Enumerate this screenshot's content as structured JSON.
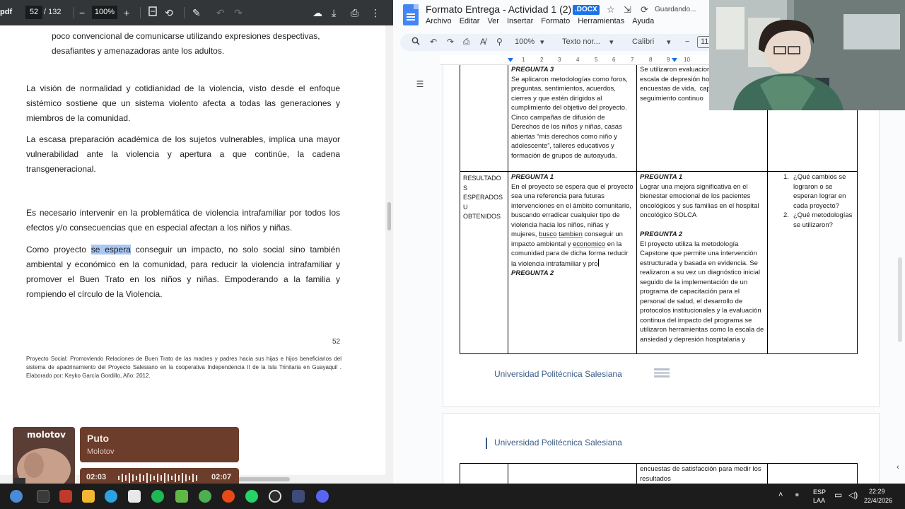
{
  "pdf_viewer": {
    "title_fragment": "pdf",
    "current_page": "52",
    "total_pages": "/ 132",
    "zoom": "100%",
    "paragraphs": {
      "p0_line1": "poco convencional de comunicarse utilizando expresiones despectivas,",
      "p0_line2": "desafiantes y amenazadoras ante los adultos.",
      "p1": "La visión de normalidad y cotidianidad de la violencia, visto desde el enfoque sistémico sostiene que un sistema violento afecta a todas las generaciones y miembros de la comunidad.",
      "p2": "La escasa preparación académica de los sujetos vulnerables, implica una mayor vulnerabilidad ante la violencia y apertura a que continúe, la cadena transgeneracional.",
      "p3": "Es necesario intervenir en la problemática de violencia intrafamiliar  por todos los efectos y/o consecuencias que en especial afectan a los niños y niñas.",
      "p4_before": "Como proyecto ",
      "p4_highlight": "se espera",
      "p4_after": " conseguir un impacto, no solo social sino también ambiental y económico en la comunidad, para reducir la violencia intrafamiliar y promover el Buen Trato en los niños y niñas. Empoderando a la familia y rompiendo el círculo de la Violencia."
    },
    "page_number": "52",
    "footer_note": "Proyecto Social: Promoviendo Relaciones de Buen Trato de las madres y padres hacia sus hijas e hijos beneficiarios del sistema de apadrinamiento del Proyecto Salesiano en la cooperativa Independencia II de la Isla Trinitaria en Guayaquil . Elaborado por: Keyko García Gordillo, Año: 2012."
  },
  "docs": {
    "title": "Formato Entrega - Actividad 1 (2)",
    "badge": ".DOCX",
    "save_status": "Guardando...",
    "menu": [
      "Archivo",
      "Editar",
      "Ver",
      "Insertar",
      "Formato",
      "Herramientas",
      "Ayuda"
    ],
    "toolbar": {
      "zoom": "100%",
      "style": "Texto nor...",
      "font": "Calibri",
      "font_size": "11"
    },
    "ruler_numbers": [
      "1",
      "2",
      "3",
      "4",
      "5",
      "6",
      "7",
      "8",
      "9",
      "10"
    ],
    "table_top": {
      "col2_title": "PREGUNTA 3",
      "col2_text": "Se aplicaron metodologías como foros, preguntas, sentimientos, acuerdos, cierres y que estén dirigidos al cumplimiento del objetivo del proyecto.\nCinco campañas de difusión de Derechos de los niños y niñas, casas abiertas “mis derechos como niño y adolescente”, talleres educativos y formación de grupos de autoayuda.",
      "col3_text": "Se utilizaron evaluaciones como la escala de depresión hospitalaria, encuestas de vida,  capacitaciones a seguimiento continuo"
    },
    "table_results": {
      "label": "RESULTADO\nS\nESPERADOS\nU\nOBTENIDOS",
      "col2_q1": "PREGUNTA 1",
      "col2_text_a": "En el proyecto se espera que el proyecto sea una referencia para futuras intervenciones en el ámbito comunitario, buscando erradicar cualquier tipo de violencia hacia los niños, niñas y mujeres, ",
      "col2_busco": "busco",
      "col2_mid": " ",
      "col2_tambien": "tambien",
      "col2_text_b": " conseguir un impacto ambiental y ",
      "col2_economico": "economico",
      "col2_text_c": " en la comunidad para de dicha forma reducir la violencia intrafamiliar y pro",
      "col2_q2": "PREGUNTA 2",
      "col3_q1": "PREGUNTA 1",
      "col3_text1": "Lograr una mejora significativa en el bienestar emocional de los pacientes oncológicos y sus familias en el hospital oncológico SOLCA",
      "col3_q2": "PREGUNTA 2",
      "col3_text2": "El proyecto utiliza la metodología Capstone que permite una intervención estructurada y basada en evidencia. Se realizaron a su vez un diagnóstico inicial seguido de la implementación de un programa de capacitación para el personal de salud, el desarrollo de protocolos institucionales y la evaluación continua del impacto del programa se utilizaron herramientas como la escala de ansiedad y depresión hospitalaria y",
      "col4_item1": "¿Qué cambios se lograron o se esperan lograr en cada proyecto?",
      "col4_item2": "¿Qué metodologías se utilizaron?"
    },
    "footer_university": "Universidad Politécnica Salesiana",
    "header_university": "Universidad Politécnica Salesiana",
    "page2_text": "encuestas de satisfacción para medir los resultados"
  },
  "music": {
    "album_logo": "molotov",
    "song": "Puto",
    "artist": "Molotov",
    "elapsed": "02:03",
    "duration": "02:07"
  },
  "tray": {
    "lang_line1": "ESP",
    "lang_line2": "LAA",
    "time": "22:29",
    "date": "22/4/2026"
  },
  "colors": {
    "pdf_toolbar": "#323639",
    "docs_blue": "#1a73e8",
    "music_card": "#6d3d2c",
    "taskbar": "#1c1c1c",
    "highlight": "#a9c7f3",
    "university_blue": "#3b5c86"
  }
}
